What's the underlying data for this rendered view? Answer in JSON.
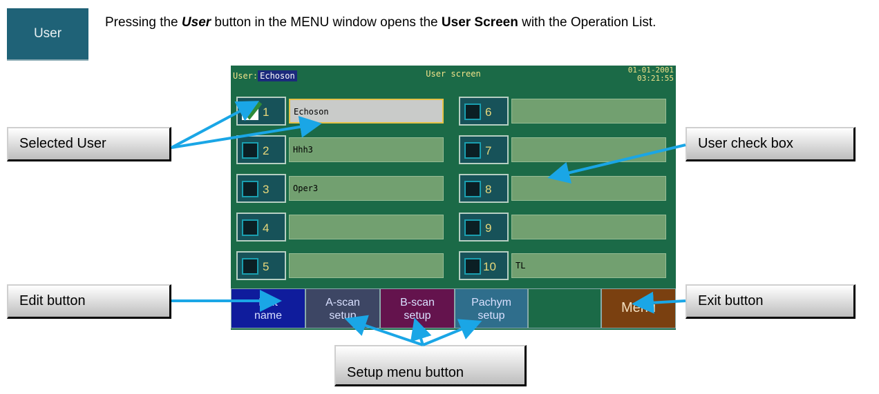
{
  "user_button": {
    "label": "User"
  },
  "intro": {
    "part1": "Pressing the ",
    "user_word": "User",
    "part2": " button in the MENU window opens the ",
    "screen_word": "User Screen",
    "part3": " with the Operation List."
  },
  "screen": {
    "user_label": "User:",
    "user_value": "Echoson",
    "title": "User screen",
    "date": "01-01-2001",
    "time": "03:21:55"
  },
  "users": [
    {
      "num": "1",
      "name": "Echoson",
      "checked": true
    },
    {
      "num": "2",
      "name": "Hhh3",
      "checked": false
    },
    {
      "num": "3",
      "name": "Oper3",
      "checked": false
    },
    {
      "num": "4",
      "name": "",
      "checked": false
    },
    {
      "num": "5",
      "name": "",
      "checked": false
    },
    {
      "num": "6",
      "name": "",
      "checked": false
    },
    {
      "num": "7",
      "name": "",
      "checked": false
    },
    {
      "num": "8",
      "name": "",
      "checked": false
    },
    {
      "num": "9",
      "name": "",
      "checked": false
    },
    {
      "num": "10",
      "name": "TL",
      "checked": false
    }
  ],
  "buttons": {
    "edit_line1": "Edit",
    "edit_line2": "name",
    "ascan_line1": "A-scan",
    "ascan_line2": "setup",
    "bscan_line1": "B-scan",
    "bscan_line2": "setup",
    "pachy_line1": "Pachym",
    "pachy_line2": "setup",
    "menu": "Menu"
  },
  "callouts": {
    "selected_user": "Selected  User",
    "user_check_box": "User check box",
    "edit_button": "Edit  button",
    "exit_button": "Exit button",
    "setup_menu_button": "Setup menu button"
  },
  "colors": {
    "arrow": "#1aa6e6",
    "panel": "#1b6a47",
    "check": "#2e8b3a"
  }
}
